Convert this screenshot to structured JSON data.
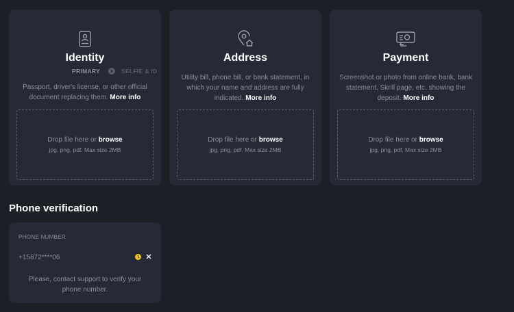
{
  "colors": {
    "background": "#1d1f27",
    "card": "#262936",
    "text_muted": "#8c8f9c",
    "text_strong": "#ffffff",
    "pending": "#f0c419"
  },
  "documents": [
    {
      "icon": "id-card-icon",
      "title": "Identity",
      "steps": {
        "primary": "PRIMARY",
        "secondary": "SELFIE & ID"
      },
      "description": "Passport, driver's license, or other official document replacing them.",
      "more_info": "More info",
      "drop": {
        "text": "Drop file here or",
        "browse": "browse",
        "hint": "jpg, png, pdf. Max size 2MB"
      }
    },
    {
      "icon": "location-home-icon",
      "title": "Address",
      "description": "Utility bill, phone bill, or bank statement, in which your name and address are fully indicated.",
      "more_info": "More info",
      "drop": {
        "text": "Drop file here or",
        "browse": "browse",
        "hint": "jpg, png, pdf. Max size 2MB"
      }
    },
    {
      "icon": "payment-icon",
      "title": "Payment",
      "description": "Screenshot or photo from online bank, bank statement, Skrill page, etc. showing the deposit.",
      "more_info": "More info",
      "drop": {
        "text": "Drop file here or",
        "browse": "browse",
        "hint": "jpg, png, pdf. Max size 2MB"
      }
    }
  ],
  "phone": {
    "section_title": "Phone verification",
    "label": "PHONE NUMBER",
    "value": "+15872****06",
    "status_icon": "pending-icon",
    "clear_icon": "close-icon",
    "note": "Please, contact support to verify your phone number."
  }
}
